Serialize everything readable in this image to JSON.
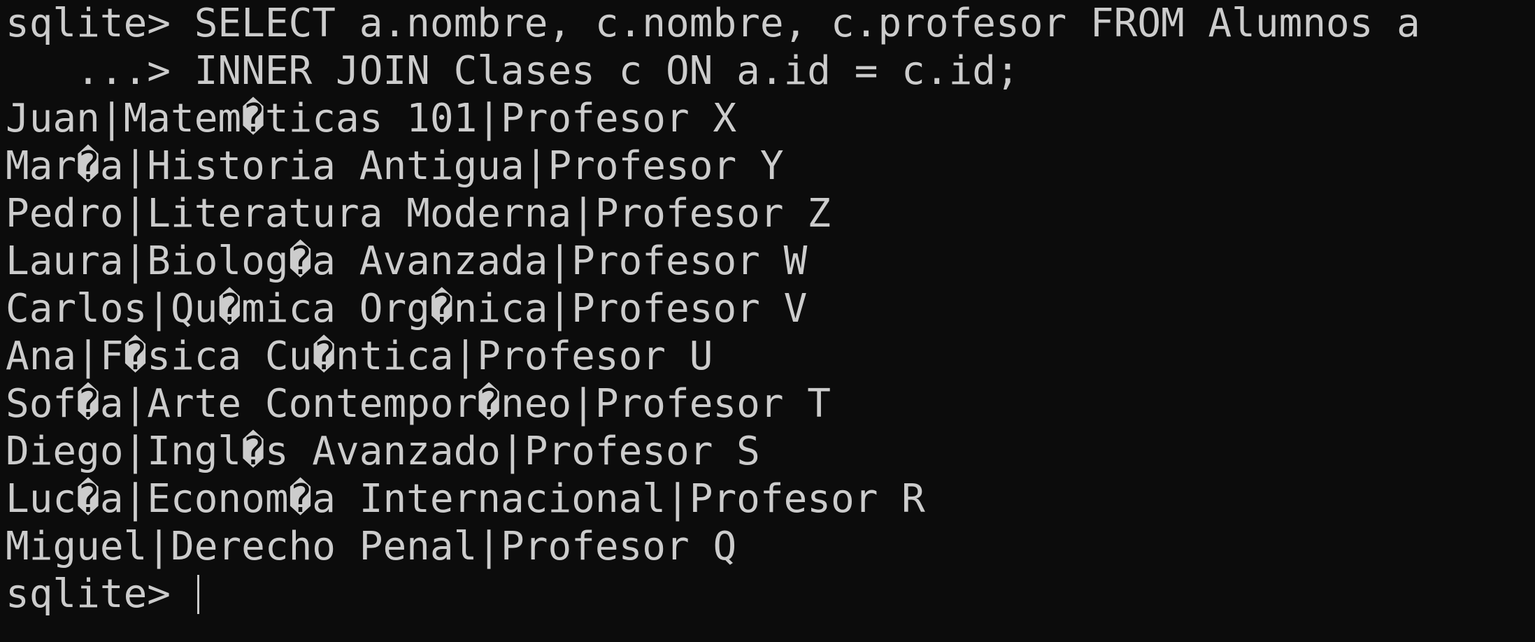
{
  "terminal": {
    "prompt": "sqlite> ",
    "continuation_prompt": "   ...> ",
    "query": {
      "line1": "SELECT a.nombre, c.nombre, c.profesor FROM Alumnos a",
      "line2": "INNER JOIN Clases c ON a.id = c.id;"
    },
    "results": [
      "Juan|Matem�ticas 101|Profesor X",
      "Mar�a|Historia Antigua|Profesor Y",
      "Pedro|Literatura Moderna|Profesor Z",
      "Laura|Biolog�a Avanzada|Profesor W",
      "Carlos|Qu�mica Org�nica|Profesor V",
      "Ana|F�sica Cu�ntica|Profesor U",
      "Sof�a|Arte Contempor�neo|Profesor T",
      "Diego|Ingl�s Avanzado|Profesor S",
      "Luc�a|Econom�a Internacional|Profesor R",
      "Miguel|Derecho Penal|Profesor Q"
    ],
    "colors": {
      "background": "#0c0c0c",
      "foreground": "#cccccc"
    }
  }
}
